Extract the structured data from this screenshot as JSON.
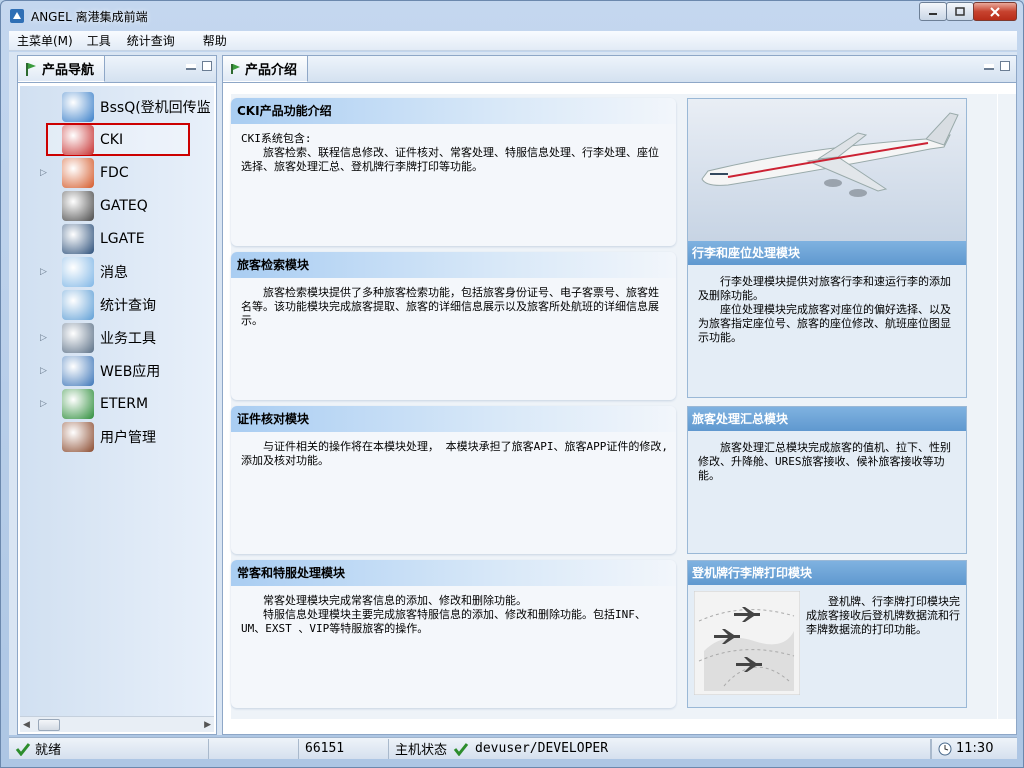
{
  "window": {
    "title": "ANGEL 离港集成前端"
  },
  "menu": {
    "items": [
      "主菜单(M)",
      "工具",
      "统计查询",
      "帮助"
    ]
  },
  "nav": {
    "title": "产品导航",
    "items": [
      {
        "label": "BssQ(登机回传监",
        "icon": "server-monitor-icon",
        "color": "#3a7fc9",
        "arrow": false
      },
      {
        "label": "CKI",
        "icon": "passport-icon",
        "color": "#c62f2f",
        "arrow": false
      },
      {
        "label": "FDC",
        "icon": "chart-users-icon",
        "color": "#d45a2a",
        "arrow": true
      },
      {
        "label": "GATEQ",
        "icon": "gate-machine-icon",
        "color": "#4a4a4a",
        "arrow": false
      },
      {
        "label": "LGATE",
        "icon": "airplane-icon",
        "color": "#2b4f7a",
        "arrow": false
      },
      {
        "label": "消息",
        "icon": "message-bubble-icon",
        "color": "#7fb6e6",
        "arrow": true
      },
      {
        "label": "统计查询",
        "icon": "magnifier-icon",
        "color": "#5f9fd6",
        "arrow": false
      },
      {
        "label": "业务工具",
        "icon": "tools-icon",
        "color": "#5a6f86",
        "arrow": true
      },
      {
        "label": "WEB应用",
        "icon": "monitor-icon",
        "color": "#3c75b8",
        "arrow": true
      },
      {
        "label": "ETERM",
        "icon": "globe-icon",
        "color": "#2d8d3a",
        "arrow": true
      },
      {
        "label": "用户管理",
        "icon": "user-icon",
        "color": "#8a4a2e",
        "arrow": false
      }
    ]
  },
  "main": {
    "title": "产品介绍",
    "cards": [
      {
        "title": "CKI产品功能介绍",
        "lines": [
          "CKI系统包含:",
          "旅客检索、联程信息修改、证件核对、常客处理、特服信息处理、行李处理、座位选择、旅客处理汇总、登机牌行李牌打印等功能。"
        ]
      },
      {
        "title": "旅客检索模块",
        "lines": [
          "旅客检索模块提供了多种旅客检索功能，包括旅客身份证号、电子客票号、旅客姓名等。该功能模块完成旅客提取、旅客的详细信息展示以及旅客所处航班的详细信息展示。"
        ]
      },
      {
        "title": "证件核对模块",
        "lines": [
          "与证件相关的操作将在本模块处理， 本模块承担了旅客API、旅客APP证件的修改,添加及核对功能。"
        ]
      },
      {
        "title": "常客和特服处理模块",
        "lines": [
          "常客处理模块完成常客信息的添加、修改和删除功能。",
          "特服信息处理模块主要完成旅客特服信息的添加、修改和删除功能。包括INF、UM、EXST 、VIP等特服旅客的操作。"
        ]
      }
    ],
    "side_cards": [
      {
        "title": "行李和座位处理模块",
        "lines": [
          "行李处理模块提供对旅客行李和速运行李的添加及删除功能。",
          "座位处理模块完成旅客对座位的偏好选择、以及为旅客指定座位号、旅客的座位修改、航班座位图显示功能。"
        ]
      },
      {
        "title": "旅客处理汇总模块",
        "lines": [
          "旅客处理汇总模块完成旅客的值机、拉下、性别修改、升降舱、URES旅客接收、候补旅客接收等功能。"
        ]
      },
      {
        "title": "登机牌行李牌打印模块",
        "lines": [
          "登机牌、行李牌打印模块完成旅客接收后登机牌数据流和行李牌数据流的打印功能。"
        ]
      }
    ]
  },
  "status": {
    "ready": "就绪",
    "code": "66151",
    "host_label": "主机状态",
    "user": "devuser/DEVELOPER",
    "time": "11:30"
  },
  "colors": {
    "selection_outline": "#cc0000",
    "card_header": "#a9cdf2",
    "side_header": "#6aa3d8"
  }
}
